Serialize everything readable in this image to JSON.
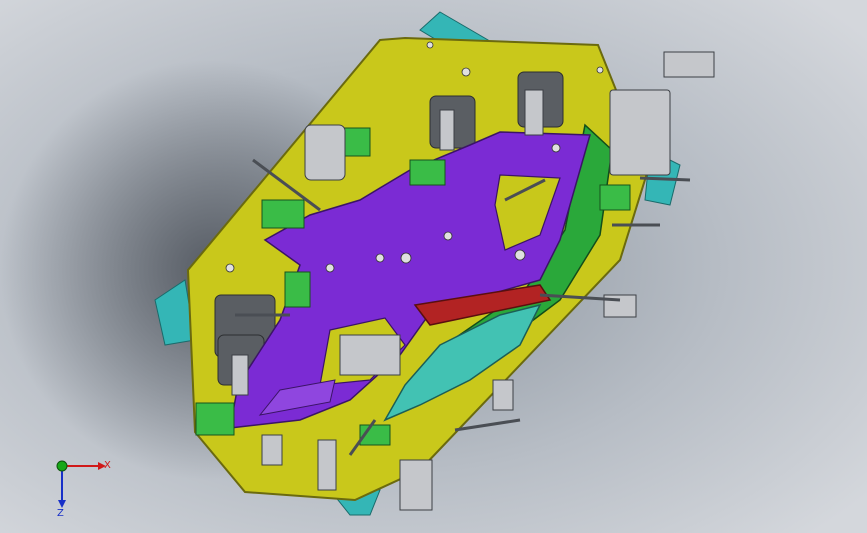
{
  "viewport": {
    "colors": {
      "background_light": "#c9cdd3",
      "background_dark": "#8e96a1",
      "base_plate": "#c8c81a",
      "base_plate_edge": "#6e6e10",
      "corner_blocks": "#32b4b4",
      "part_purple": "#7a2ad0",
      "part_green": "#2aa83a",
      "part_teal": "#3ec1b4",
      "part_red": "#b02020",
      "clamp_grey": "#c2c4c8"
    }
  },
  "axis_triad": {
    "x_label": "X",
    "z_label": "Z",
    "x_color": "#d01818",
    "y_color": "#18a818",
    "z_color": "#1830c8"
  }
}
